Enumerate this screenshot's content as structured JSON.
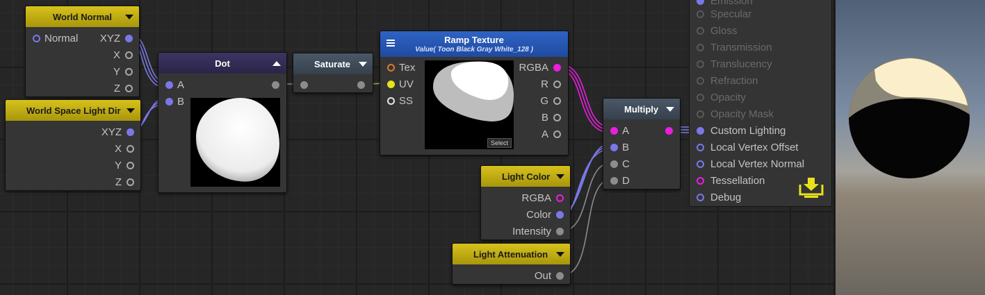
{
  "colors": {
    "vector_port": "#7a78e6",
    "color_port": "#ea1ee0",
    "float_port": "#8c8c8c",
    "uv_port": "#e8e21a",
    "tex_port": "#e07a23",
    "node_header_yellow": "#d7c21c",
    "node_header_blue": "#2f63c4"
  },
  "nodes": {
    "world_normal": {
      "title": "World Normal",
      "input_label": "Normal",
      "outputs": [
        "XYZ",
        "X",
        "Y",
        "Z"
      ]
    },
    "world_space_light_dir": {
      "title": "World Space Light Dir",
      "outputs": [
        "XYZ",
        "X",
        "Y",
        "Z"
      ]
    },
    "dot": {
      "title": "Dot",
      "inputs": [
        "A",
        "B"
      ]
    },
    "saturate": {
      "title": "Saturate"
    },
    "ramp_texture": {
      "title": "Ramp Texture",
      "subtitle": "Value( Toon Black Gray White_128 )",
      "inputs": [
        "Tex",
        "UV",
        "SS"
      ],
      "outputs": [
        "RGBA",
        "R",
        "G",
        "B",
        "A"
      ],
      "select_label": "Select"
    },
    "light_color": {
      "title": "Light Color",
      "outputs": [
        "RGBA",
        "Color",
        "Intensity"
      ]
    },
    "light_attenuation": {
      "title": "Light Attenuation",
      "outputs": [
        "Out"
      ]
    },
    "multiply": {
      "title": "Multiply",
      "inputs": [
        "A",
        "B",
        "C",
        "D"
      ]
    }
  },
  "master": {
    "inputs_disabled": [
      "Emission",
      "Specular",
      "Gloss",
      "Transmission",
      "Translucency",
      "Refraction",
      "Opacity",
      "Opacity Mask"
    ],
    "inputs_enabled": [
      "Custom Lighting",
      "Local Vertex Offset",
      "Local Vertex Normal",
      "Tessellation",
      "Debug"
    ],
    "action_icon": "download-icon"
  }
}
